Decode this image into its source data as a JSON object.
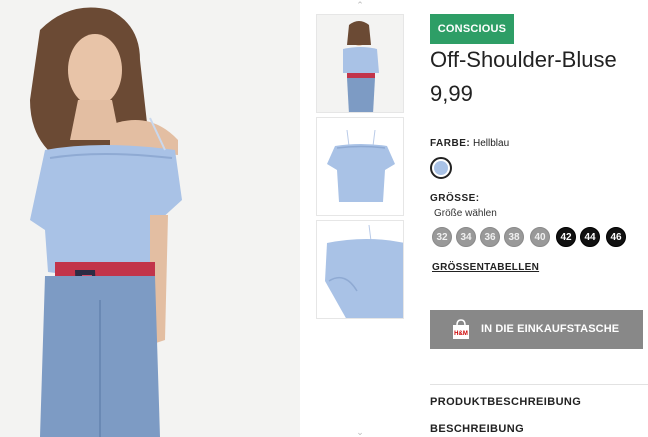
{
  "product": {
    "badge": "CONSCIOUS",
    "title": "Off-Shoulder-Bluse",
    "price": "9,99"
  },
  "color": {
    "label": "FARBE:",
    "value": "Hellblau",
    "swatch_color": "#a9c2e6"
  },
  "size": {
    "label": "GRÖSSE:",
    "prompt": "Größe wählen",
    "options": [
      {
        "value": "32",
        "available": false
      },
      {
        "value": "34",
        "available": false
      },
      {
        "value": "36",
        "available": false
      },
      {
        "value": "38",
        "available": false
      },
      {
        "value": "40",
        "available": false
      },
      {
        "value": "42",
        "available": true
      },
      {
        "value": "44",
        "available": true
      },
      {
        "value": "46",
        "available": true
      }
    ],
    "chart_link": "GRÖSSENTABELLEN"
  },
  "cart": {
    "button_label": "IN DIE EINKAUFSTASCHE",
    "bag_logo": "H&M"
  },
  "sections": {
    "product_description": "PRODUKTBESCHREIBUNG",
    "description": "BESCHREIBUNG"
  },
  "colors": {
    "badge": "#2e9e66",
    "cart_button": "#888888",
    "blouse": "#a9c2e6",
    "jeans": "#7d9bc4"
  }
}
